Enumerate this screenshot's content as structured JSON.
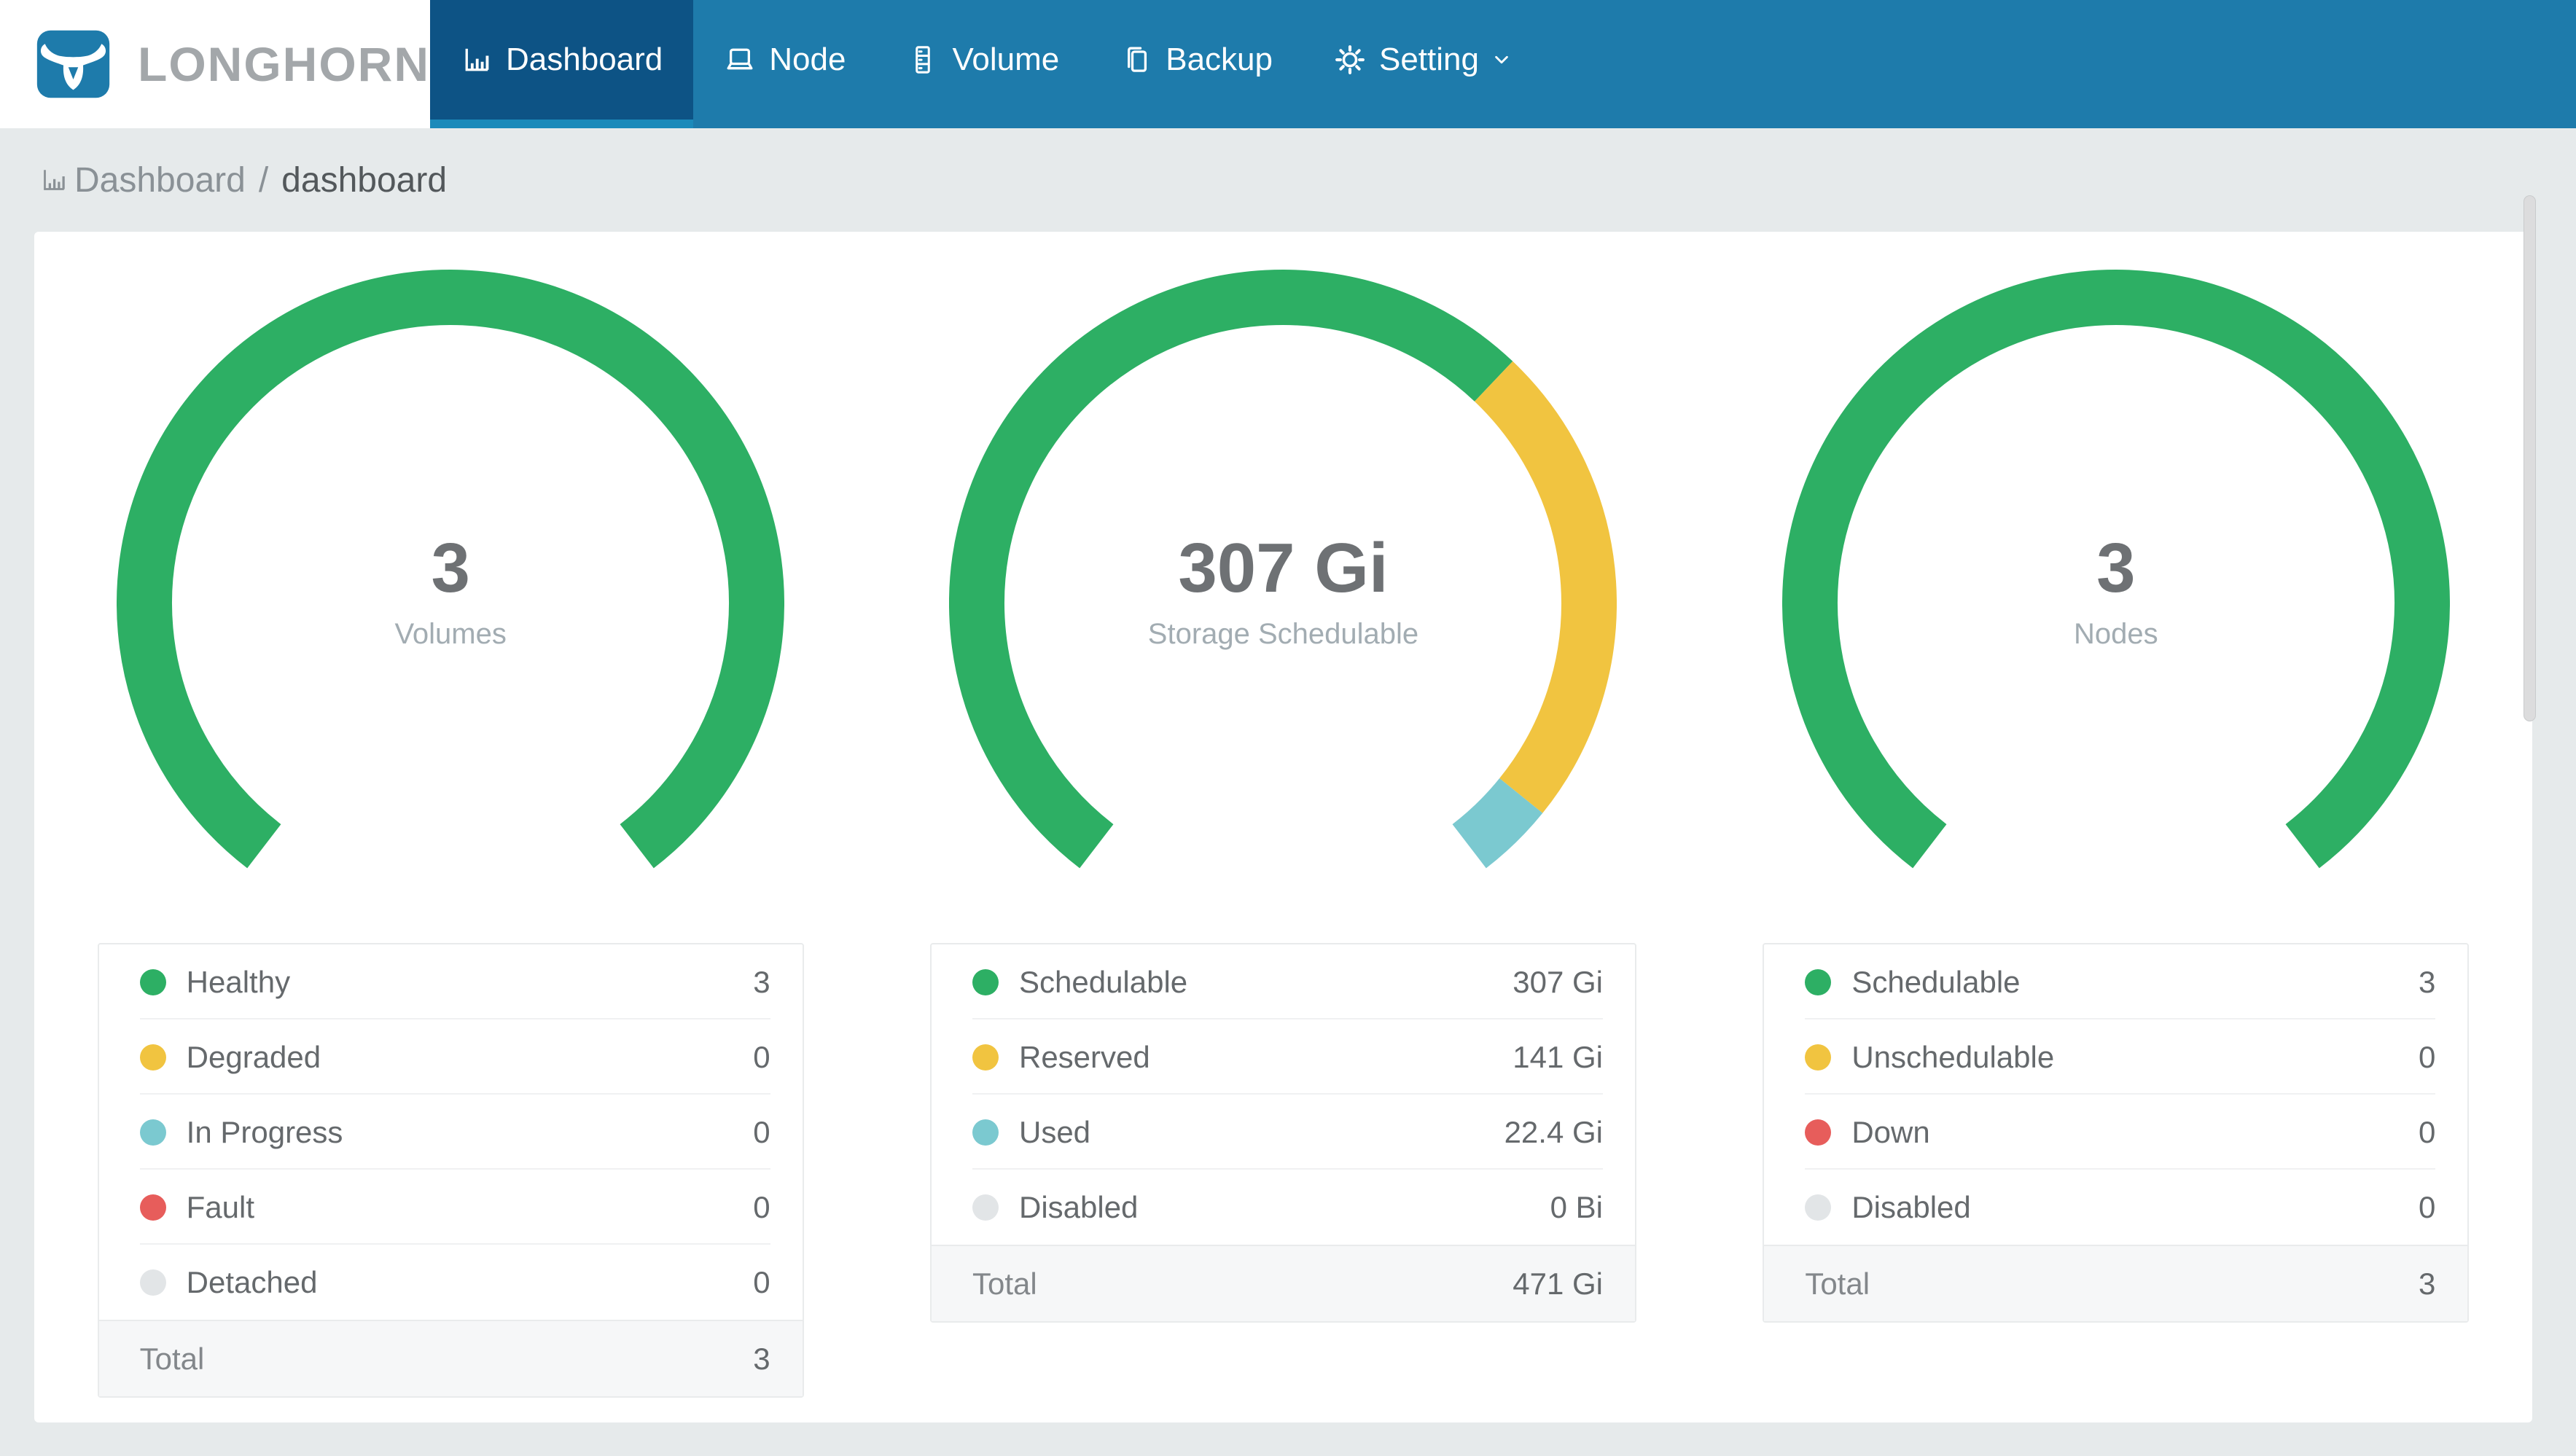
{
  "header": {
    "brand": "LONGHORN",
    "nav": [
      {
        "label": "Dashboard",
        "active": true
      },
      {
        "label": "Node",
        "active": false
      },
      {
        "label": "Volume",
        "active": false
      },
      {
        "label": "Backup",
        "active": false
      },
      {
        "label": "Setting",
        "active": false,
        "has_dropdown": true
      }
    ]
  },
  "breadcrumb": {
    "section": "Dashboard",
    "separator": "/",
    "page": "dashboard"
  },
  "colors": {
    "nav_blue": "#1e7bab",
    "active_tab_blue": "#0d5385",
    "active_tab_underline": "#1c8aba",
    "green": "#2daf64",
    "yellow": "#f1c440",
    "teal": "#7bc9d0",
    "red": "#e75d5b",
    "gray": "#e2e5e7",
    "page_bg": "#e6eaeb"
  },
  "cards": [
    {
      "name": "volumes",
      "center_value": "3",
      "center_label": "Volumes",
      "rows": [
        {
          "label": "Healthy",
          "value": "3",
          "color": "#2daf64"
        },
        {
          "label": "Degraded",
          "value": "0",
          "color": "#f1c440"
        },
        {
          "label": "In Progress",
          "value": "0",
          "color": "#7bc9d0"
        },
        {
          "label": "Fault",
          "value": "0",
          "color": "#e75d5b"
        },
        {
          "label": "Detached",
          "value": "0",
          "color": "#e2e5e7"
        }
      ],
      "total": {
        "label": "Total",
        "value": "3"
      }
    },
    {
      "name": "storage-schedulable",
      "center_value": "307 Gi",
      "center_label": "Storage Schedulable",
      "rows": [
        {
          "label": "Schedulable",
          "value": "307 Gi",
          "color": "#2daf64"
        },
        {
          "label": "Reserved",
          "value": "141 Gi",
          "color": "#f1c440"
        },
        {
          "label": "Used",
          "value": "22.4 Gi",
          "color": "#7bc9d0"
        },
        {
          "label": "Disabled",
          "value": "0 Bi",
          "color": "#e2e5e7"
        }
      ],
      "total": {
        "label": "Total",
        "value": "471 Gi"
      }
    },
    {
      "name": "nodes",
      "center_value": "3",
      "center_label": "Nodes",
      "rows": [
        {
          "label": "Schedulable",
          "value": "3",
          "color": "#2daf64"
        },
        {
          "label": "Unschedulable",
          "value": "0",
          "color": "#f1c440"
        },
        {
          "label": "Down",
          "value": "0",
          "color": "#e75d5b"
        },
        {
          "label": "Disabled",
          "value": "0",
          "color": "#e2e5e7"
        }
      ],
      "total": {
        "label": "Total",
        "value": "3"
      }
    }
  ],
  "chart_data": [
    {
      "type": "gauge",
      "title": "3",
      "subtitle": "Volumes",
      "sweep_deg": 285,
      "start_angle_deg": 217.5,
      "gap_position": "bottom",
      "total": 3,
      "series": [
        {
          "name": "Healthy",
          "value": 3,
          "color": "#2daf64"
        },
        {
          "name": "Degraded",
          "value": 0,
          "color": "#f1c440"
        },
        {
          "name": "In Progress",
          "value": 0,
          "color": "#7bc9d0"
        },
        {
          "name": "Fault",
          "value": 0,
          "color": "#e75d5b"
        },
        {
          "name": "Detached",
          "value": 0,
          "color": "#e2e5e7"
        }
      ]
    },
    {
      "type": "gauge",
      "title": "307 Gi",
      "subtitle": "Storage Schedulable",
      "sweep_deg": 285,
      "start_angle_deg": 217.5,
      "gap_position": "bottom",
      "total": 470.4,
      "series": [
        {
          "name": "Schedulable",
          "value": 307,
          "color": "#2daf64"
        },
        {
          "name": "Reserved",
          "value": 141,
          "color": "#f1c440"
        },
        {
          "name": "Used",
          "value": 22.4,
          "color": "#7bc9d0"
        },
        {
          "name": "Disabled",
          "value": 0,
          "color": "#e2e5e7"
        }
      ]
    },
    {
      "type": "gauge",
      "title": "3",
      "subtitle": "Nodes",
      "sweep_deg": 285,
      "start_angle_deg": 217.5,
      "gap_position": "bottom",
      "total": 3,
      "series": [
        {
          "name": "Schedulable",
          "value": 3,
          "color": "#2daf64"
        },
        {
          "name": "Unschedulable",
          "value": 0,
          "color": "#f1c440"
        },
        {
          "name": "Down",
          "value": 0,
          "color": "#e75d5b"
        },
        {
          "name": "Disabled",
          "value": 0,
          "color": "#e2e5e7"
        }
      ]
    }
  ]
}
